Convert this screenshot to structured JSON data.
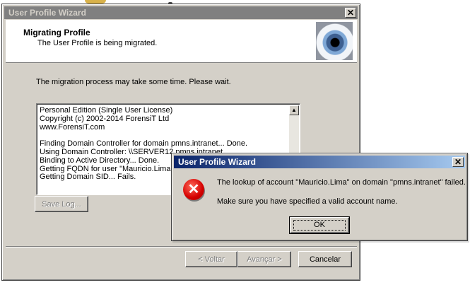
{
  "wizard": {
    "title": "User Profile Wizard",
    "header_title": "Migrating Profile",
    "header_subtitle": "The User Profile is being migrated.",
    "info": "The migration process may take some time. Please wait.",
    "log_lines": [
      "Personal Edition (Single User License)",
      "Copyright (c) 2002-2014 ForensiT Ltd",
      "www.ForensiT.com",
      "",
      "Finding Domain Controller for domain pmns.intranet... Done.",
      "Using Domain Controller: \\\\SERVER12.pmns.intranet",
      "Binding to Active Directory... Done.",
      "Getting FQDN for user \"Mauricio.Lima\"... Done.",
      "Getting Domain SID... Fails."
    ],
    "save_log_label": "Save Log...",
    "back_label": "< Voltar",
    "next_label": "Avançar >",
    "cancel_label": "Cancelar"
  },
  "dialog": {
    "title": "User Profile Wizard",
    "message_line1": "The lookup of account \"Mauricio.Lima\" on domain \"pmns.intranet\" failed.",
    "message_line2": "Make sure you have specified a valid account name.",
    "ok_label": "OK",
    "icon": "error-icon"
  }
}
